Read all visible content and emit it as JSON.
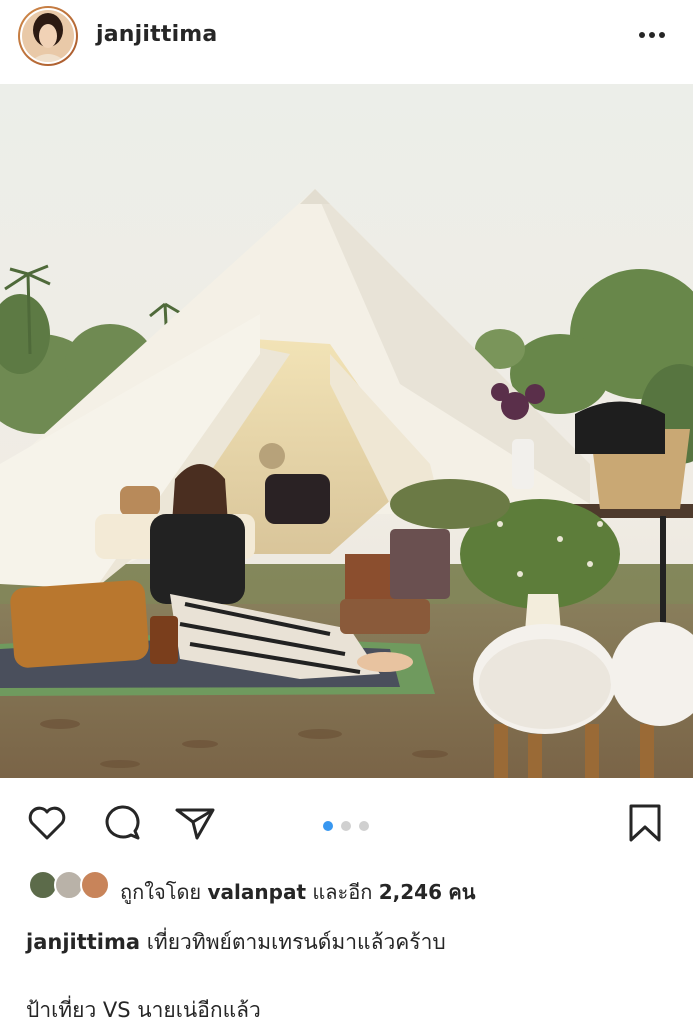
{
  "header": {
    "username": "janjittima",
    "avatar_icon": "profile-avatar",
    "more_icon": "more-horizontal-icon"
  },
  "photo": {
    "page_indicator": {
      "current": 1,
      "total": 3
    },
    "colors": {
      "sky": "#eef0ea",
      "tent": "#f3efe4",
      "grass": "#9c8a6a"
    }
  },
  "actions": {
    "like_icon": "heart-icon",
    "comment_icon": "comment-icon",
    "share_icon": "send-icon",
    "save_icon": "bookmark-icon",
    "active_dot_color": "#3897f0"
  },
  "likes": {
    "prefix": "ถูกใจโดย",
    "user": "valanpat",
    "middle": "และอีก",
    "count": "2,246",
    "suffix": "คน"
  },
  "caption": {
    "user": "janjittima",
    "text": "เที่ยวทิพย์ตามเทรนด์มาแล้วคร้าบ",
    "line2": "ป้าเที่ยว VS นายเน่อีกแล้ว"
  }
}
